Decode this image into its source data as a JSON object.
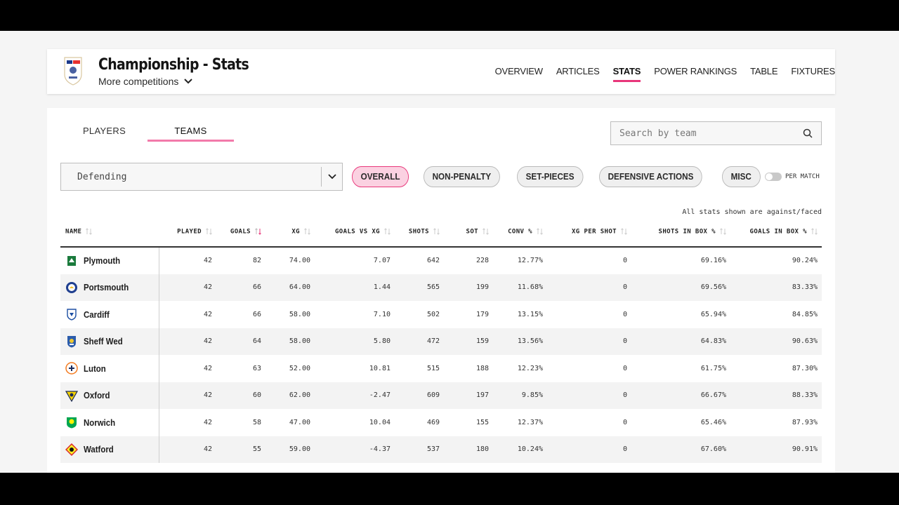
{
  "header": {
    "title": "Championship - Stats",
    "more_competitions": "More competitions",
    "nav": [
      {
        "label": "OVERVIEW",
        "active": false
      },
      {
        "label": "ARTICLES",
        "active": false
      },
      {
        "label": "STATS",
        "active": true
      },
      {
        "label": "POWER RANKINGS",
        "active": false
      },
      {
        "label": "TABLE",
        "active": false
      },
      {
        "label": "FIXTURES",
        "active": false
      }
    ]
  },
  "tabs": [
    {
      "label": "PLAYERS",
      "active": false
    },
    {
      "label": "TEAMS",
      "active": true
    }
  ],
  "search": {
    "placeholder": "Search by team"
  },
  "category": {
    "selected": "Defending"
  },
  "filters": [
    {
      "label": "OVERALL",
      "active": true
    },
    {
      "label": "NON-PENALTY",
      "active": false
    },
    {
      "label": "SET-PIECES",
      "active": false
    },
    {
      "label": "DEFENSIVE ACTIONS",
      "active": false
    },
    {
      "label": "MISC",
      "active": false
    }
  ],
  "per_match": {
    "label": "PER MATCH",
    "on": false
  },
  "note": "All stats shown are against/faced",
  "table": {
    "columns": [
      "NAME",
      "PLAYED",
      "GOALS",
      "XG",
      "GOALS VS XG",
      "SHOTS",
      "SOT",
      "CONV %",
      "XG PER SHOT",
      "SHOTS IN BOX %",
      "GOALS IN BOX %"
    ],
    "sorted_column": "GOALS",
    "rows": [
      {
        "team": "Plymouth",
        "crest": "plymouth-crest",
        "cells": [
          "42",
          "82",
          "74.00",
          "7.07",
          "642",
          "228",
          "12.77%",
          "0",
          "69.16%",
          "90.24%"
        ]
      },
      {
        "team": "Portsmouth",
        "crest": "portsmouth-crest",
        "cells": [
          "42",
          "66",
          "64.00",
          "1.44",
          "565",
          "199",
          "11.68%",
          "0",
          "69.56%",
          "83.33%"
        ]
      },
      {
        "team": "Cardiff",
        "crest": "cardiff-crest",
        "cells": [
          "42",
          "66",
          "58.00",
          "7.10",
          "502",
          "179",
          "13.15%",
          "0",
          "65.94%",
          "84.85%"
        ]
      },
      {
        "team": "Sheff Wed",
        "crest": "sheff-wed-crest",
        "cells": [
          "42",
          "64",
          "58.00",
          "5.80",
          "472",
          "159",
          "13.56%",
          "0",
          "64.83%",
          "90.63%"
        ]
      },
      {
        "team": "Luton",
        "crest": "luton-crest",
        "cells": [
          "42",
          "63",
          "52.00",
          "10.81",
          "515",
          "188",
          "12.23%",
          "0",
          "61.75%",
          "87.30%"
        ]
      },
      {
        "team": "Oxford",
        "crest": "oxford-crest",
        "cells": [
          "42",
          "60",
          "62.00",
          "-2.47",
          "609",
          "197",
          "9.85%",
          "0",
          "66.67%",
          "88.33%"
        ]
      },
      {
        "team": "Norwich",
        "crest": "norwich-crest",
        "cells": [
          "42",
          "58",
          "47.00",
          "10.04",
          "469",
          "155",
          "12.37%",
          "0",
          "65.46%",
          "87.93%"
        ]
      },
      {
        "team": "Watford",
        "crest": "watford-crest",
        "cells": [
          "42",
          "55",
          "59.00",
          "-4.37",
          "537",
          "180",
          "10.24%",
          "0",
          "67.60%",
          "90.91%"
        ]
      }
    ]
  },
  "colors": {
    "accent": "#e8367a",
    "accent_soft": "#fbd1e1"
  }
}
